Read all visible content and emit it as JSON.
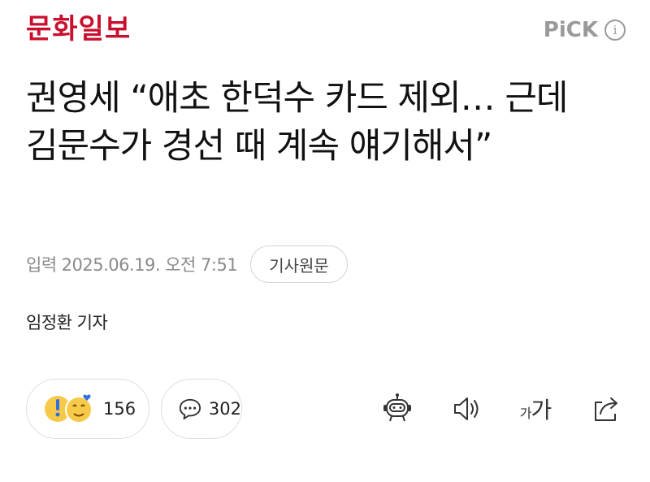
{
  "header": {
    "logo": "문화일보",
    "pick_label": "PiCK",
    "info_icon": "info-icon"
  },
  "article": {
    "headline": "권영세 “애초 한덕수 카드 제외… 근데 김문수가 경선 때 계속 얘기해서”",
    "date_label": "입력",
    "date_value": "2025.06.19. 오전 7:51",
    "original_button": "기사원문",
    "reporter": "임정환 기자"
  },
  "actions": {
    "reaction_count": "156",
    "comment_count": "302",
    "icons": [
      "surprised-emoji-icon",
      "heart-eyes-emoji-icon",
      "comment-icon",
      "robot-summary-icon",
      "speaker-icon",
      "font-size-icon",
      "share-icon"
    ],
    "font_size_small": "가",
    "font_size_large": "가"
  },
  "colors": {
    "brand_red": "#c8102e",
    "muted_gray": "#8a8a8a",
    "pick_gray": "#9a9a9a",
    "emoji_yellow": "#f7c948",
    "emoji_blue": "#2f6fdf"
  }
}
